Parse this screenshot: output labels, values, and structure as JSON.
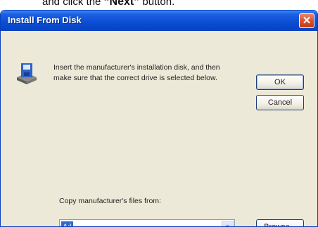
{
  "caption": {
    "prefix": "and click the ",
    "bold": "“Next”",
    "suffix": " button."
  },
  "window": {
    "title": "Install From Disk",
    "close_glyph": "✕"
  },
  "icon": {
    "name": "floppy-disk-icon"
  },
  "message": "Insert the manufacturer's installation disk, and then make sure that the correct drive is selected below.",
  "buttons": {
    "ok": "OK",
    "cancel": "Cancel",
    "browse": "Browse..."
  },
  "copy_from": {
    "label": "Copy manufacturer's files from:",
    "value": "A:\\",
    "arrow_glyph": "▼"
  },
  "colors": {
    "title_bar": "#0a4fd6",
    "dialog_bg": "#ece9d8",
    "selection": "#316ac5",
    "close": "#d9522f"
  }
}
